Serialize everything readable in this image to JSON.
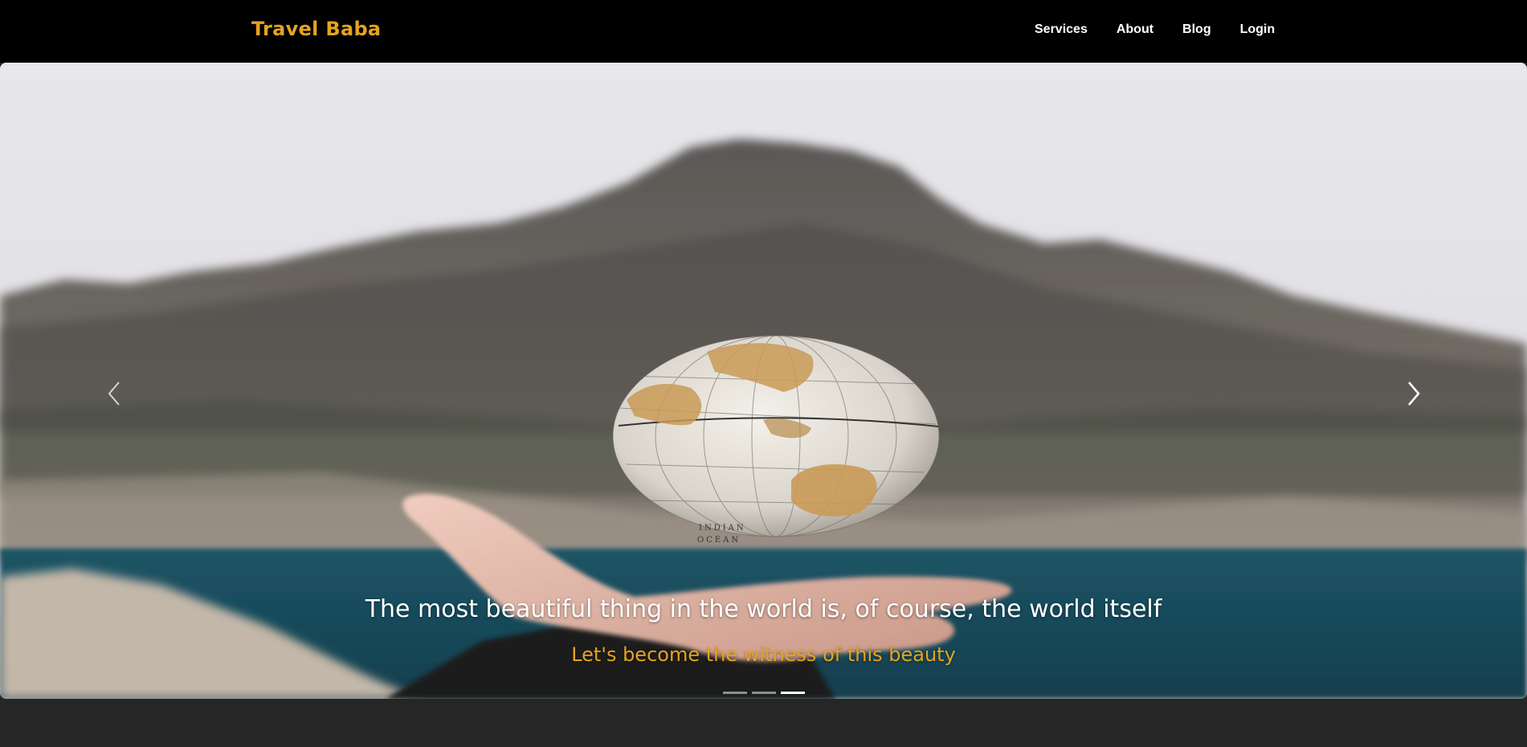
{
  "header": {
    "brand": "Travel Baba",
    "nav": [
      "Services",
      "About",
      "Blog",
      "Login"
    ]
  },
  "carousel": {
    "title": "The most beautiful thing in the world is, of course, the world itself",
    "subtitle": "Let's become the witness of this beauty",
    "slide_count": 3,
    "active_index": 2,
    "prev_icon": "chevron-left-icon",
    "next_icon": "chevron-right-icon"
  },
  "colors": {
    "brand": "#e6a320",
    "nav_bg": "#000000",
    "page_bg": "#262626",
    "nav_text": "#ffffff"
  }
}
